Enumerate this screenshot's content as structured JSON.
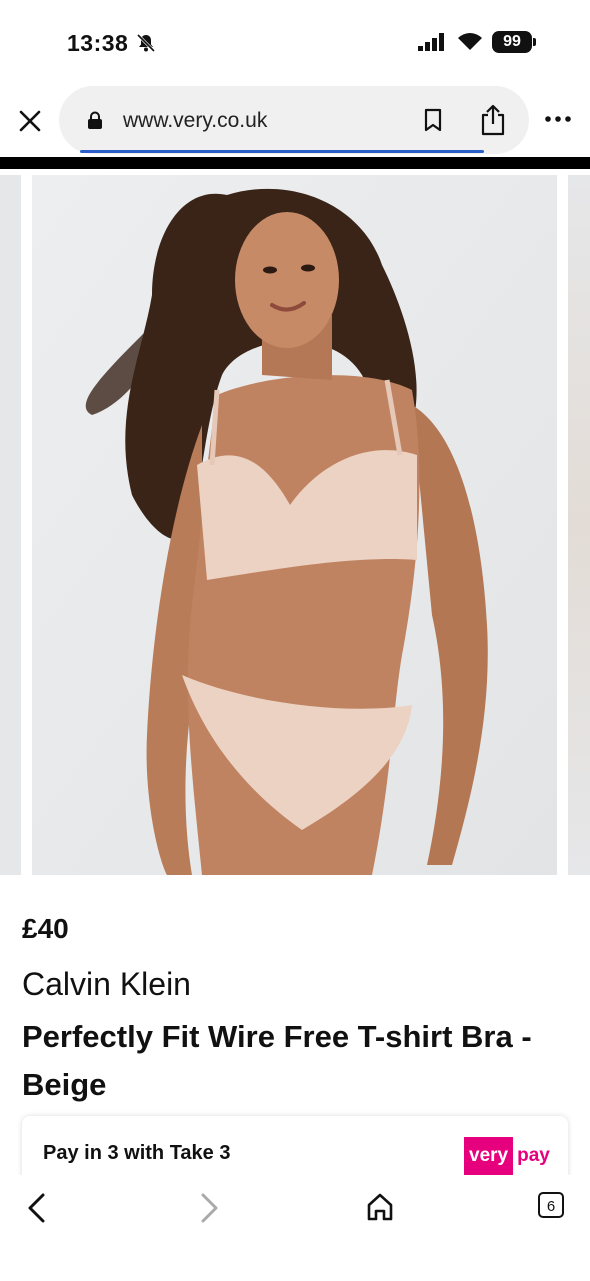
{
  "status_bar": {
    "time": "13:38",
    "battery": "99"
  },
  "browser": {
    "url": "www.very.co.uk",
    "tab_count": "6"
  },
  "product": {
    "price": "£40",
    "brand": "Calvin Klein",
    "name": "Perfectly Fit Wire Free T-shirt Bra - Beige"
  },
  "payment": {
    "text": "Pay in 3 with Take 3",
    "logo_very": "very",
    "logo_pay": "pay",
    "brand_color": "#e6007e"
  },
  "icons": {
    "close": "close-icon",
    "lock": "lock-icon",
    "bookmark": "bookmark-icon",
    "share": "share-icon",
    "more": "more-icon",
    "back": "back-icon",
    "forward": "forward-icon",
    "home": "home-icon",
    "tabs": "tabs-icon"
  }
}
